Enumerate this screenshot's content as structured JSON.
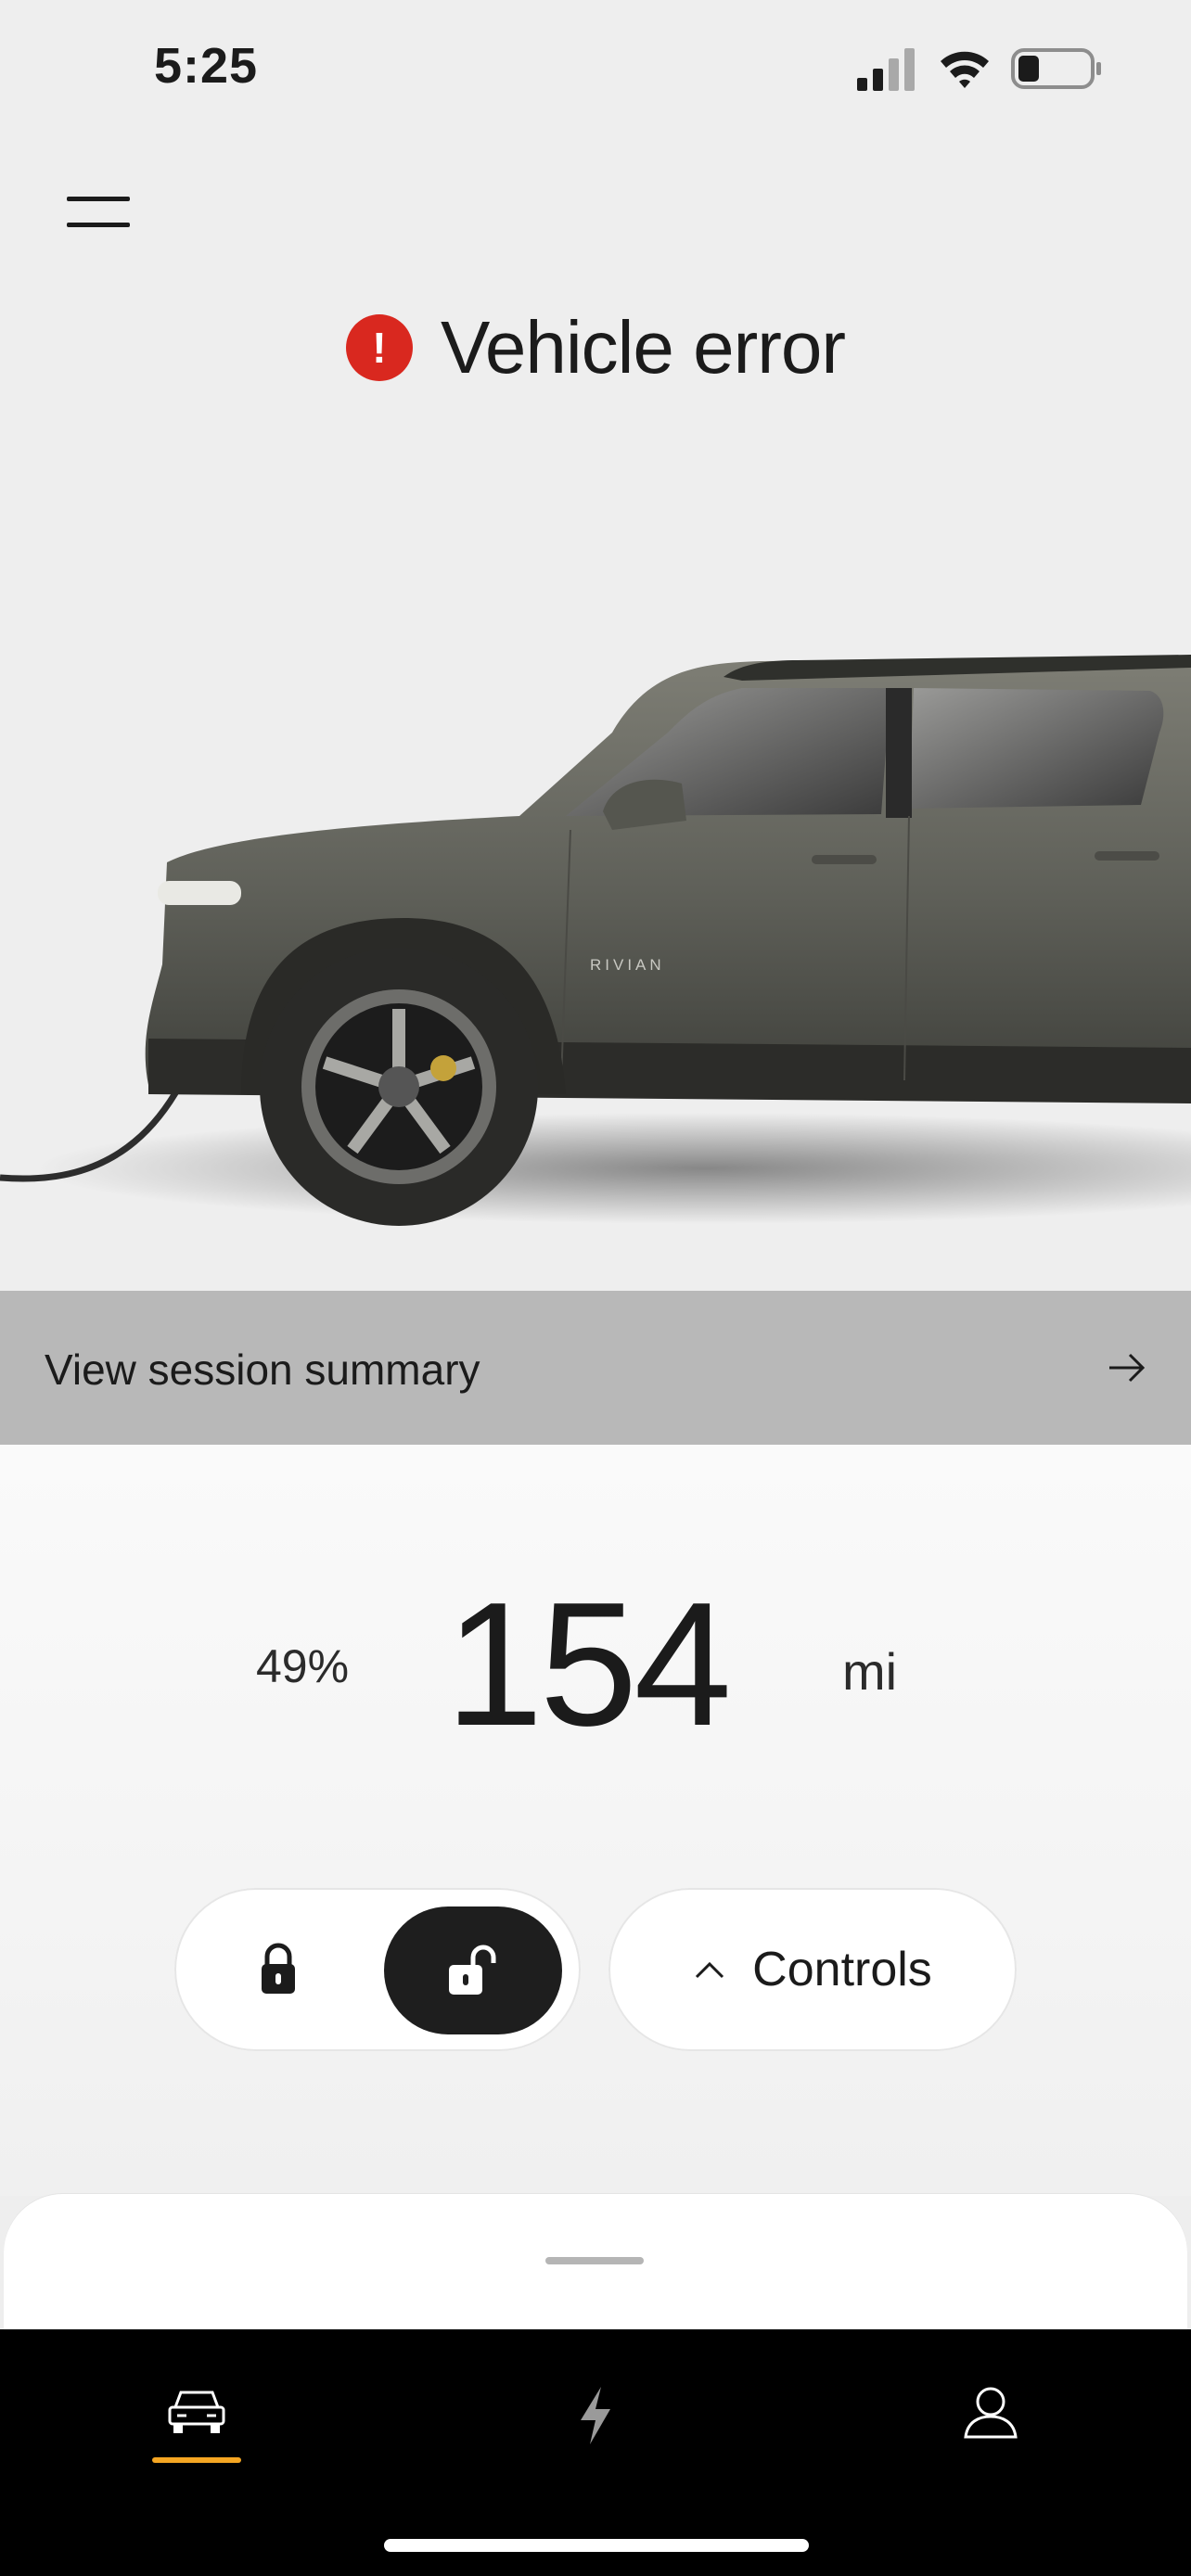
{
  "status_bar": {
    "time": "5:25"
  },
  "header": {
    "title": "Vehicle error"
  },
  "hero": {
    "brand_text": "RIVIAN"
  },
  "session": {
    "label": "View session summary"
  },
  "charge": {
    "percent": "49%",
    "range": "154",
    "unit": "mi"
  },
  "controls": {
    "label": "Controls"
  },
  "colors": {
    "error": "#d9281f",
    "accent": "#f5a623",
    "banner": "#b8b8b8"
  },
  "nav": {
    "items": [
      "vehicle-icon",
      "charging-icon",
      "profile-icon"
    ],
    "active": "vehicle-icon"
  }
}
